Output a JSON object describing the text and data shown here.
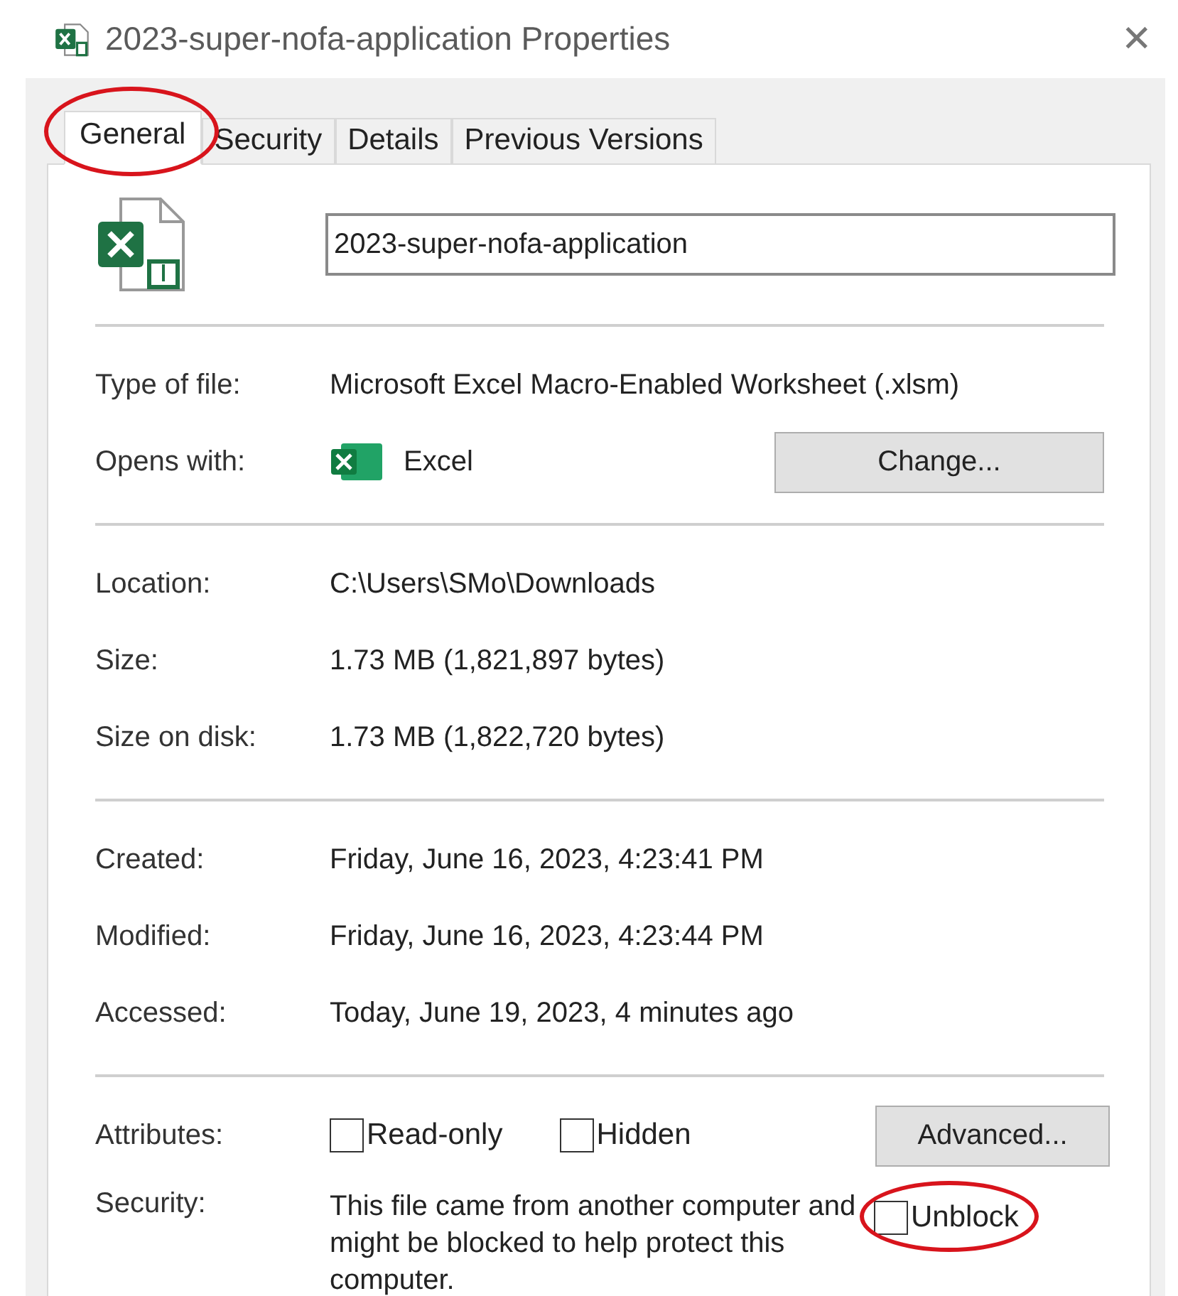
{
  "window": {
    "title": "2023-super-nofa-application Properties",
    "close": "✕"
  },
  "tabs": [
    {
      "label": "General",
      "selected": true,
      "circled": true
    },
    {
      "label": "Security",
      "selected": false,
      "circled": false
    },
    {
      "label": "Details",
      "selected": false,
      "circled": false
    },
    {
      "label": "Previous Versions",
      "selected": false,
      "circled": false
    }
  ],
  "file_name": "2023-super-nofa-application",
  "type_row": {
    "label": "Type of file:",
    "value": "Microsoft Excel Macro-Enabled Worksheet (.xlsm)"
  },
  "opens_with": {
    "label": "Opens with:",
    "app": "Excel",
    "button": "Change..."
  },
  "location_rows": [
    {
      "label": "Location:",
      "value": "C:\\Users\\SMo\\Downloads"
    },
    {
      "label": "Size:",
      "value": "1.73 MB (1,821,897 bytes)"
    },
    {
      "label": "Size on disk:",
      "value": "1.73 MB (1,822,720 bytes)"
    }
  ],
  "date_rows": [
    {
      "label": "Created:",
      "value": "Friday, June 16, 2023, 4:23:41 PM"
    },
    {
      "label": "Modified:",
      "value": "Friday, June 16, 2023, 4:23:44 PM"
    },
    {
      "label": "Accessed:",
      "value": "Today, June 19, 2023, 4 minutes ago"
    }
  ],
  "attributes": {
    "label": "Attributes:",
    "options": [
      {
        "label": "Read-only",
        "checked": false
      },
      {
        "label": "Hidden",
        "checked": false
      }
    ],
    "button": "Advanced..."
  },
  "security": {
    "label": "Security:",
    "message": "This file came from another computer and might be blocked to help protect this computer.",
    "unblock": {
      "label": "Unblock",
      "checked": false,
      "circled": true
    }
  }
}
